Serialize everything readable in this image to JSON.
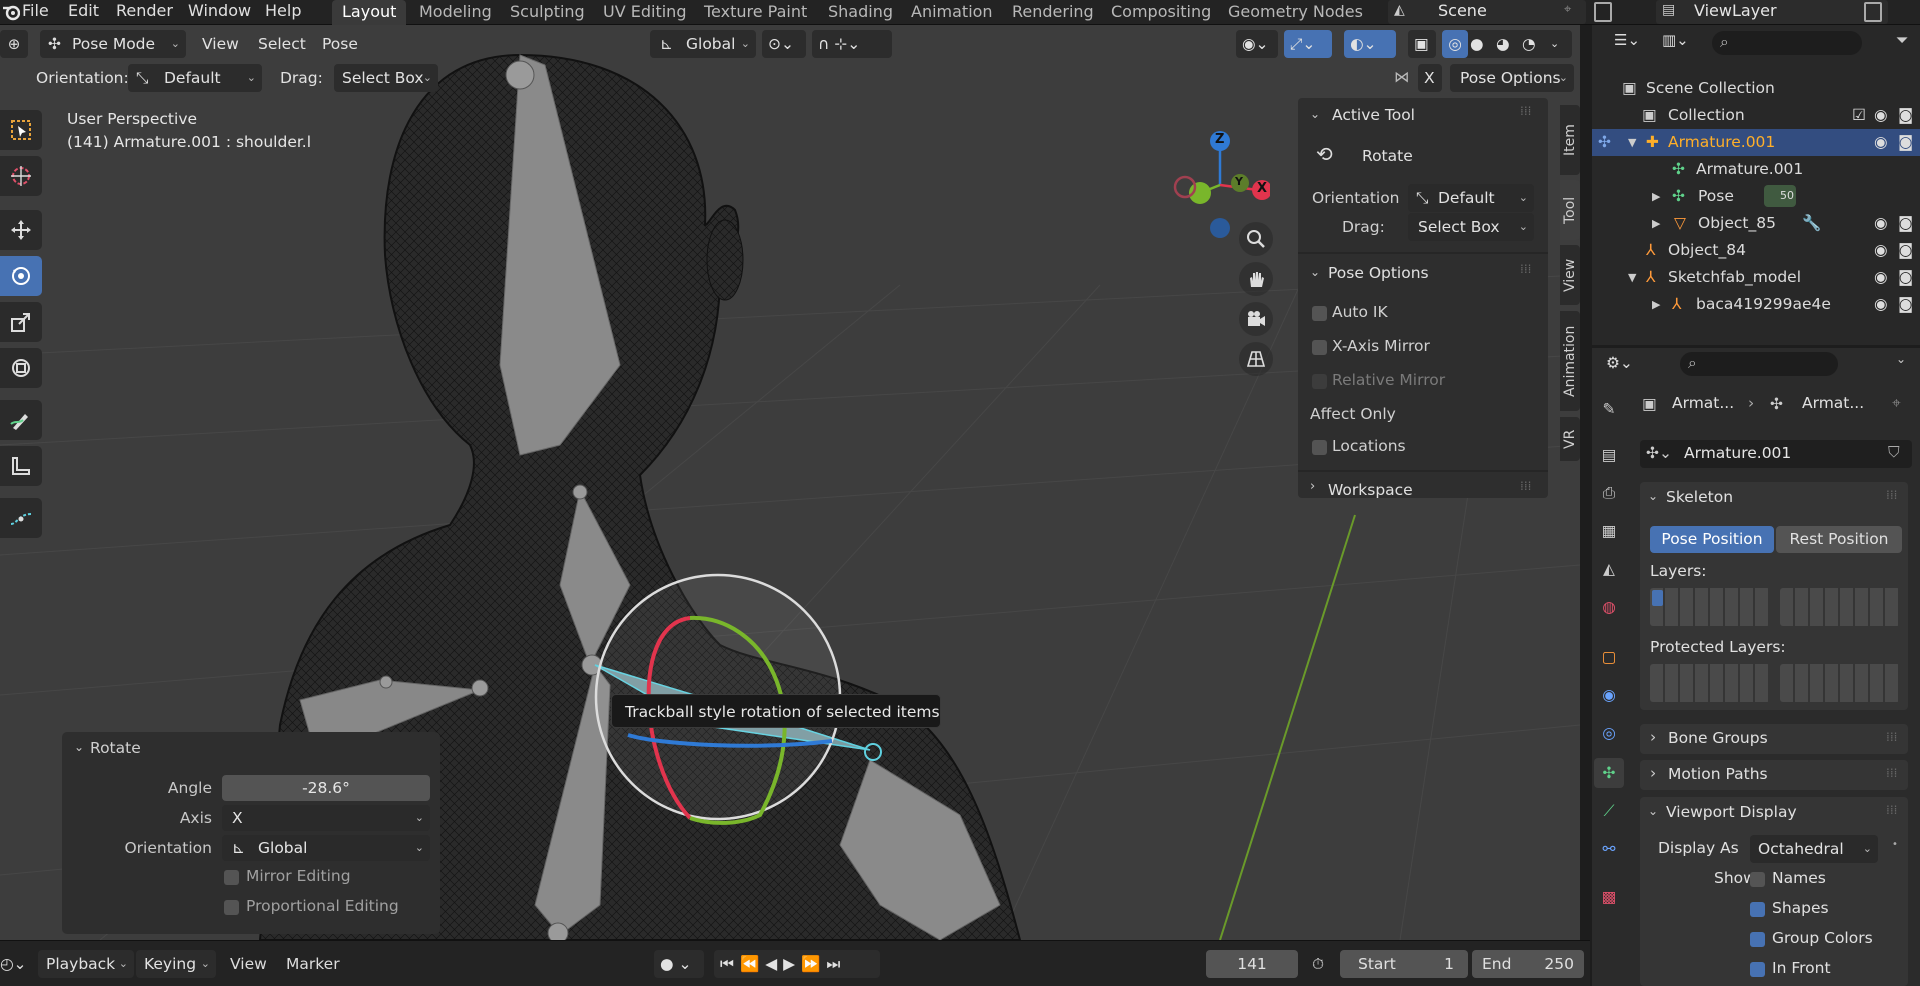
{
  "topbar": {
    "menus": [
      "File",
      "Edit",
      "Render",
      "Window",
      "Help"
    ],
    "workspaces": [
      "Layout",
      "Modeling",
      "Sculpting",
      "UV Editing",
      "Texture Paint",
      "Shading",
      "Animation",
      "Rendering",
      "Compositing",
      "Geometry Nodes"
    ],
    "active_workspace": "Layout",
    "scene": "Scene",
    "view_layer": "ViewLayer"
  },
  "viewport_header": {
    "mode": "Pose Mode",
    "menus": [
      "View",
      "Select",
      "Pose"
    ],
    "transform_orientation": "Global"
  },
  "tool_header": {
    "orientation_label": "Orientation:",
    "orientation_value": "Default",
    "drag_label": "Drag:",
    "drag_value": "Select Box",
    "x_label": "X",
    "pose_options": "Pose Options"
  },
  "overlay": {
    "perspective": "User Perspective",
    "object_info": "(141) Armature.001 : shoulder.l"
  },
  "gizmo_axes": {
    "z": "Z",
    "x": "X",
    "y": "Y"
  },
  "tooltip": "Trackball style rotation of selected items",
  "npanel": {
    "active_tool_header": "Active Tool",
    "tool_name": "Rotate",
    "orientation_label": "Orientation",
    "orientation_value": "Default",
    "drag_label": "Drag:",
    "drag_value": "Select Box",
    "pose_options_header": "Pose Options",
    "auto_ik": "Auto IK",
    "x_axis_mirror": "X-Axis Mirror",
    "relative_mirror": "Relative Mirror",
    "affect_only": "Affect Only",
    "locations": "Locations",
    "workspace": "Workspace",
    "tabs": [
      "Item",
      "Tool",
      "View",
      "Animation",
      "VR"
    ]
  },
  "operator_panel": {
    "title": "Rotate",
    "angle_label": "Angle",
    "angle_value": "-28.6°",
    "axis_label": "Axis",
    "axis_value": "X",
    "orientation_label": "Orientation",
    "orientation_value": "Global",
    "mirror_editing": "Mirror Editing",
    "proportional_editing": "Proportional Editing"
  },
  "outliner": {
    "scene_collection": "Scene Collection",
    "rows": [
      {
        "label": "Collection"
      },
      {
        "label": "Armature.001"
      },
      {
        "label": "Armature.001"
      },
      {
        "label": "Pose"
      },
      {
        "label": "Object_85"
      },
      {
        "label": "Object_84"
      },
      {
        "label": "Sketchfab_model"
      },
      {
        "label": "baca419299ae4e"
      }
    ],
    "pose_badge": "50"
  },
  "properties": {
    "breadcrumb_1": "Armat...",
    "breadcrumb_2": "Armat...",
    "data_name": "Armature.001",
    "skeleton": "Skeleton",
    "pose_position": "Pose Position",
    "rest_position": "Rest Position",
    "layers": "Layers:",
    "protected_layers": "Protected Layers:",
    "bone_groups": "Bone Groups",
    "motion_paths": "Motion Paths",
    "viewport_display": "Viewport Display",
    "display_as_label": "Display As",
    "display_as_value": "Octahedral",
    "show_label": "Show",
    "names": "Names",
    "shapes": "Shapes",
    "group_colors": "Group Colors",
    "in_front": "In Front"
  },
  "timeline": {
    "playback": "Playback",
    "keying": "Keying",
    "view": "View",
    "marker": "Marker",
    "current_frame": "141",
    "start_label": "Start",
    "start_value": "1",
    "end_label": "End",
    "end_value": "250"
  },
  "colors": {
    "accent": "#4772b3",
    "selected_row": "#334d80",
    "axis_x": "#e2344d",
    "axis_y": "#79b62b",
    "axis_z": "#2f7ad5",
    "outliner_active_text": "#ffaf29"
  }
}
